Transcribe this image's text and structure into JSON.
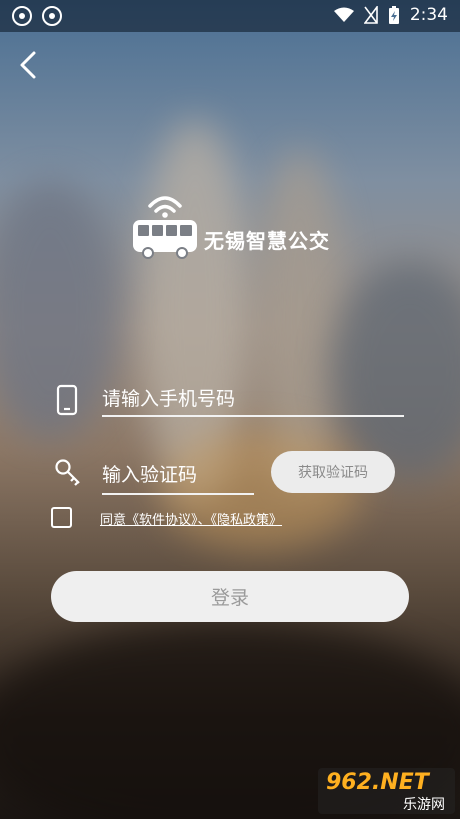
{
  "status_bar": {
    "time": "2:34"
  },
  "app": {
    "logo_text": "无锡智慧公交"
  },
  "form": {
    "phone_placeholder": "请输入手机号码",
    "code_placeholder": "输入验证码",
    "get_code_label": "获取验证码",
    "agreement_text": "同意《软件协议》、《隐私政策》",
    "login_label": "登录"
  },
  "watermark": {
    "brand": "962.NET",
    "subtitle": "乐游网"
  },
  "icons": {
    "back": "back-chevron-icon",
    "bus": "bus-wifi-icon",
    "phone": "phone-icon",
    "key": "key-icon"
  }
}
